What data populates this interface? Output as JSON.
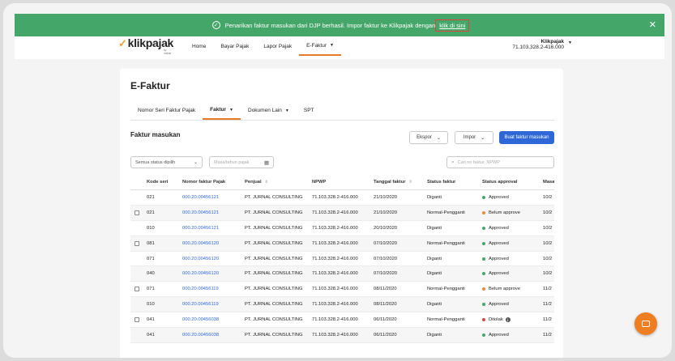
{
  "banner": {
    "message": "Penarikan faktur masukan dari DJP berhasil. Impor faktur ke Klikpajak dengan",
    "link": "klik di sini",
    "close": "✕"
  },
  "nav": {
    "logo": "klikpajak",
    "logo_sub": "by mekari",
    "items": [
      "Home",
      "Bayar Pajak",
      "Lapor Pajak",
      "E-Faktur"
    ],
    "user_name": "Klikpajak",
    "user_npwp": "71.103.328.2-416.000"
  },
  "page": {
    "title": "E-Faktur",
    "tabs": [
      "Nomor Seri Faktur Pajak",
      "Faktur",
      "Dokumen Lain",
      "SPT"
    ],
    "section_title": "Faktur masukan",
    "buttons": {
      "ekspor": "Ekspor",
      "impor": "Impor",
      "buat": "Buat faktur masukan"
    },
    "filters": {
      "status": "Semua status dipilih",
      "period_placeholder": "Masa/tahun pajak",
      "search_placeholder": "Cari no faktur, NPWP"
    }
  },
  "table": {
    "headers": [
      "Kode seri",
      "Nomor faktur Pajak",
      "Penjual",
      "NPWP",
      "Tanggal faktur",
      "Status faktur",
      "Status approval",
      "Masa"
    ],
    "rows": [
      {
        "kode": "021",
        "nomor": "000.20.00456121",
        "penjual": "PT. JURNAL CONSULTING",
        "npwp": "71.103.328.2-416.000",
        "tanggal": "21/10/2020",
        "status": "Diganti",
        "approval": "Approved",
        "masa": "10/2",
        "checkbox": false
      },
      {
        "kode": "021",
        "nomor": "000.20.00456121",
        "penjual": "PT. JURNAL CONSULTING",
        "npwp": "71.103.328.2-416.000",
        "tanggal": "21/10/2020",
        "status": "Normal-Pengganti",
        "approval": "Belum approve",
        "masa": "10/2",
        "checkbox": true
      },
      {
        "kode": "010",
        "nomor": "000.20.00456121",
        "penjual": "PT. JURNAL CONSULTING",
        "npwp": "71.103.328.2-416.000",
        "tanggal": "20/10/2020",
        "status": "Diganti",
        "approval": "Approved",
        "masa": "10/2",
        "checkbox": false
      },
      {
        "kode": "081",
        "nomor": "000.20.00456120",
        "penjual": "PT. JURNAL CONSULTING",
        "npwp": "71.103.328.2-416.000",
        "tanggal": "07/10/2020",
        "status": "Normal-Pengganti",
        "approval": "Approved",
        "masa": "10/2",
        "checkbox": true
      },
      {
        "kode": "071",
        "nomor": "000.20.00456120",
        "penjual": "PT. JURNAL CONSULTING",
        "npwp": "71.103.328.2-416.000",
        "tanggal": "07/10/2020",
        "status": "Diganti",
        "approval": "Approved",
        "masa": "10/2",
        "checkbox": false
      },
      {
        "kode": "040",
        "nomor": "000.20.00456120",
        "penjual": "PT. JURNAL CONSULTING",
        "npwp": "71.103.328.2-416.000",
        "tanggal": "07/10/2020",
        "status": "Diganti",
        "approval": "Approved",
        "masa": "10/2",
        "checkbox": false
      },
      {
        "kode": "071",
        "nomor": "000.20.00456119",
        "penjual": "PT. JURNAL CONSULTING",
        "npwp": "71.103.328.2-416.000",
        "tanggal": "08/11/2020",
        "status": "Normal-Pengganti",
        "approval": "Belum approve",
        "masa": "11/2",
        "checkbox": true
      },
      {
        "kode": "010",
        "nomor": "000.20.00456119",
        "penjual": "PT. JURNAL CONSULTING",
        "npwp": "71.103.328.2-416.000",
        "tanggal": "08/11/2020",
        "status": "Diganti",
        "approval": "Approved",
        "masa": "11/2",
        "checkbox": false
      },
      {
        "kode": "041",
        "nomor": "000.20.00456038",
        "penjual": "PT. JURNAL CONSULTING",
        "npwp": "71.103.328.2-416.000",
        "tanggal": "06/11/2020",
        "status": "Normal-Pengganti",
        "approval": "Ditolak",
        "masa": "11/2",
        "checkbox": true
      },
      {
        "kode": "041",
        "nomor": "000.20.00456038",
        "penjual": "PT. JURNAL CONSULTING",
        "npwp": "71.103.328.2-416.000",
        "tanggal": "06/11/2020",
        "status": "Diganti",
        "approval": "Approved",
        "masa": "11/2",
        "checkbox": false
      }
    ]
  },
  "colors": {
    "approved": "#45a66a",
    "belum": "#ef8a3a",
    "ditolak": "#e0443a"
  },
  "icons": {
    "chat": "chat-icon",
    "calendar": "calendar-icon",
    "search": "search-icon"
  }
}
